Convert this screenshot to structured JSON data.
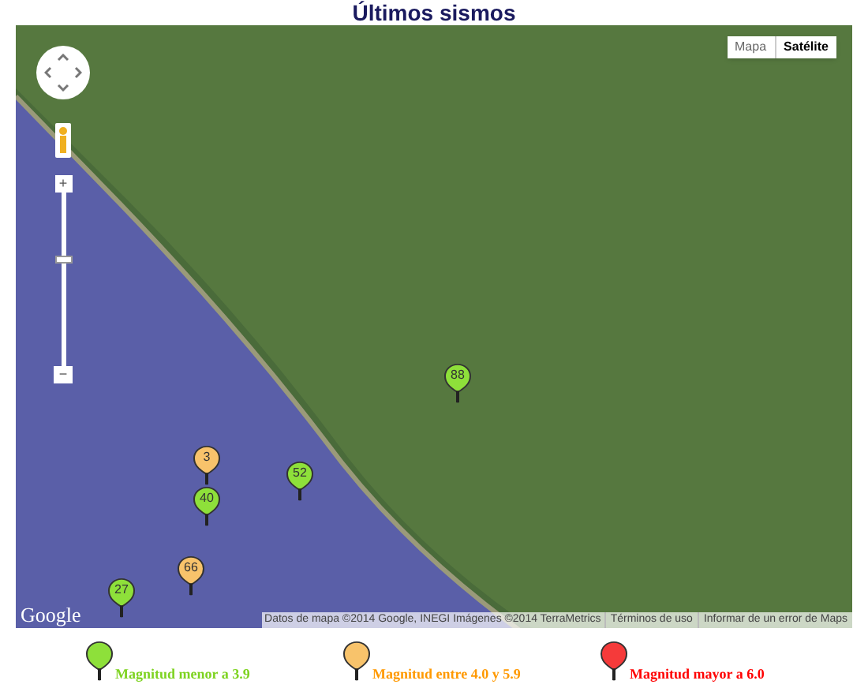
{
  "title": "Últimos sismos",
  "map": {
    "map_types": [
      {
        "label": "Mapa",
        "selected": false
      },
      {
        "label": "Satélite",
        "selected": true
      }
    ],
    "zoom": {
      "level": 0.62,
      "plus": "+",
      "minus": "−"
    },
    "markers": [
      {
        "label": "88",
        "color": "#8ee03a"
      },
      {
        "label": "3",
        "color": "#f8c36b"
      },
      {
        "label": "40",
        "color": "#8ee03a"
      },
      {
        "label": "52",
        "color": "#8ee03a"
      },
      {
        "label": "66",
        "color": "#f8c36b"
      },
      {
        "label": "27",
        "color": "#8ee03a"
      }
    ],
    "logo": "Google",
    "attribution": "Datos de mapa ©2014 Google, INEGI Imágenes ©2014 TerraMetrics",
    "links": [
      "Términos de uso",
      "Informar de un error de Maps"
    ]
  },
  "legend": [
    {
      "label": "Magnitud menor a 3.9",
      "color": "#8ee03a"
    },
    {
      "label": "Magnitud entre 4.0 y 5.9",
      "color": "#f8c36b"
    },
    {
      "label": "Magnitud mayor a 6.0",
      "color": "#f53a3a"
    }
  ]
}
